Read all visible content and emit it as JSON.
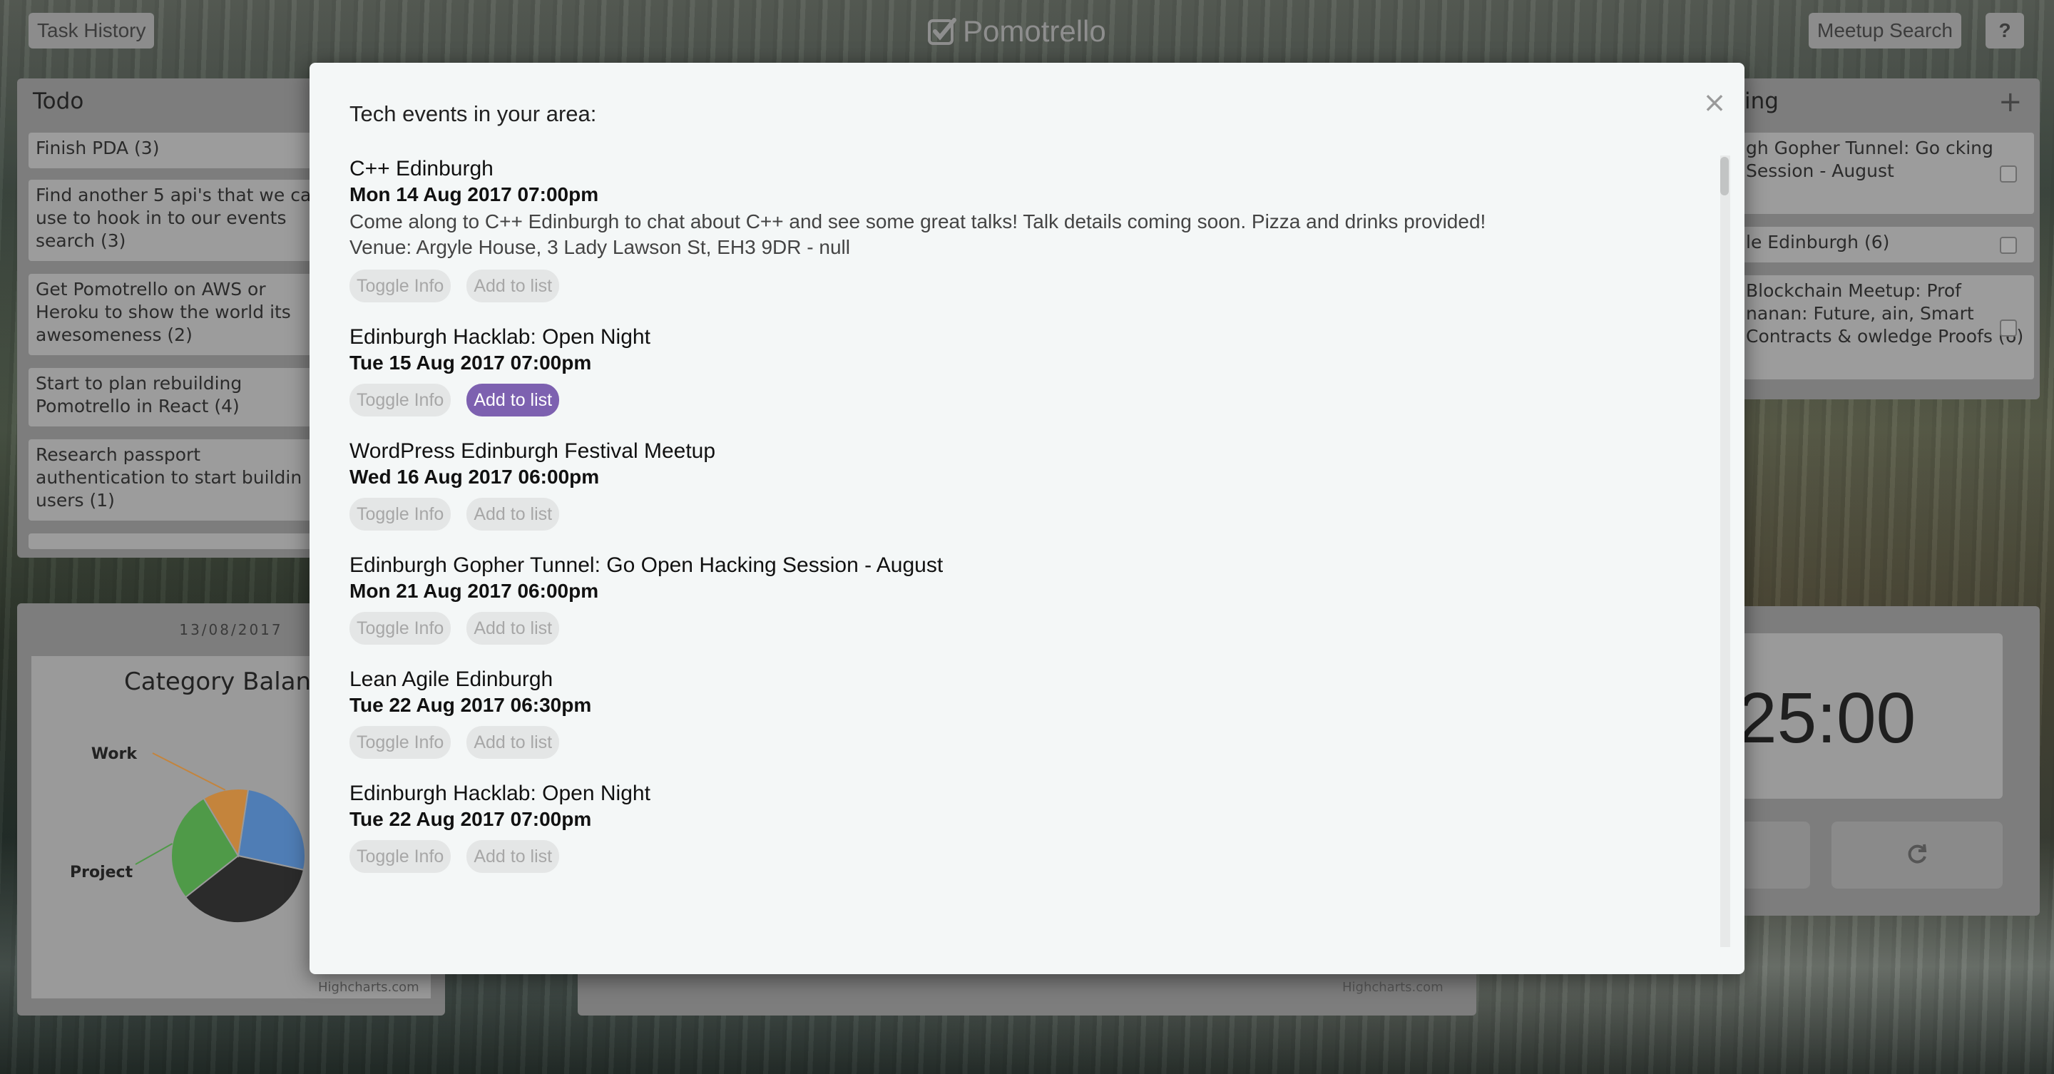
{
  "header": {
    "task_history": "Task History",
    "brand": "Pomotrello",
    "meetup_search": "Meetup Search",
    "help": "?"
  },
  "todo": {
    "title": "Todo",
    "items": [
      "Finish PDA (3)",
      "Find another 5 api's that we ca use to hook in to our events search (3)",
      "Get Pomotrello on AWS or Heroku to show the world its awesomeness (2)",
      "Start to plan rebuilding Pomotrello in React (4)",
      "Research passport authentication to start buildin users (1)"
    ]
  },
  "right_panel": {
    "title": "ing",
    "add": "+",
    "items": [
      "gh Gopher Tunnel: Go cking Session - August",
      "le Edinburgh (6)",
      "Blockchain Meetup: Prof nanan: Future, ain, Smart Contracts & owledge Proofs (6)"
    ]
  },
  "chart_panel": {
    "date": "13/08/2017",
    "title": "Category Balan",
    "credit": "Highcharts.com",
    "credit2": "Highcharts.com"
  },
  "chart_data": {
    "type": "pie",
    "title": "Category Balan",
    "labels": [
      "Work",
      "Project"
    ],
    "slices": [
      {
        "name": "",
        "value": 26,
        "color": "#4f7db5"
      },
      {
        "name": "",
        "value": 36,
        "color": "#2b2b2b"
      },
      {
        "name": "Project",
        "value": 27,
        "color": "#4f9a48"
      },
      {
        "name": "Work",
        "value": 11,
        "color": "#c4843c"
      }
    ]
  },
  "timer": {
    "time": "25:00"
  },
  "modal": {
    "heading": "Tech events in your area:",
    "close": "×",
    "toggle_label": "Toggle Info",
    "add_label": "Add to list",
    "events": [
      {
        "name": "C++ Edinburgh",
        "date": "Mon 14 Aug 2017 07:00pm",
        "description": "Come along to C++ Edinburgh to chat about C++ and see some great talks! Talk details coming soon. Pizza and drinks provided!",
        "venue": "Venue: Argyle House, 3 Lady Lawson St, EH3 9DR - null"
      },
      {
        "name": "Edinburgh Hacklab: Open Night",
        "date": "Tue 15 Aug 2017 07:00pm"
      },
      {
        "name": "WordPress Edinburgh Festival Meetup",
        "date": "Wed 16 Aug 2017 06:00pm"
      },
      {
        "name": "Edinburgh Gopher Tunnel: Go Open Hacking Session - August",
        "date": "Mon 21 Aug 2017 06:00pm"
      },
      {
        "name": "Lean Agile Edinburgh",
        "date": "Tue 22 Aug 2017 06:30pm"
      },
      {
        "name": "Edinburgh Hacklab: Open Night",
        "date": "Tue 22 Aug 2017 07:00pm"
      }
    ]
  },
  "colors": {
    "accent": "#7d61b0",
    "modal_bg": "#f4f7f7",
    "overlay_panel": "#7d7d7d"
  }
}
